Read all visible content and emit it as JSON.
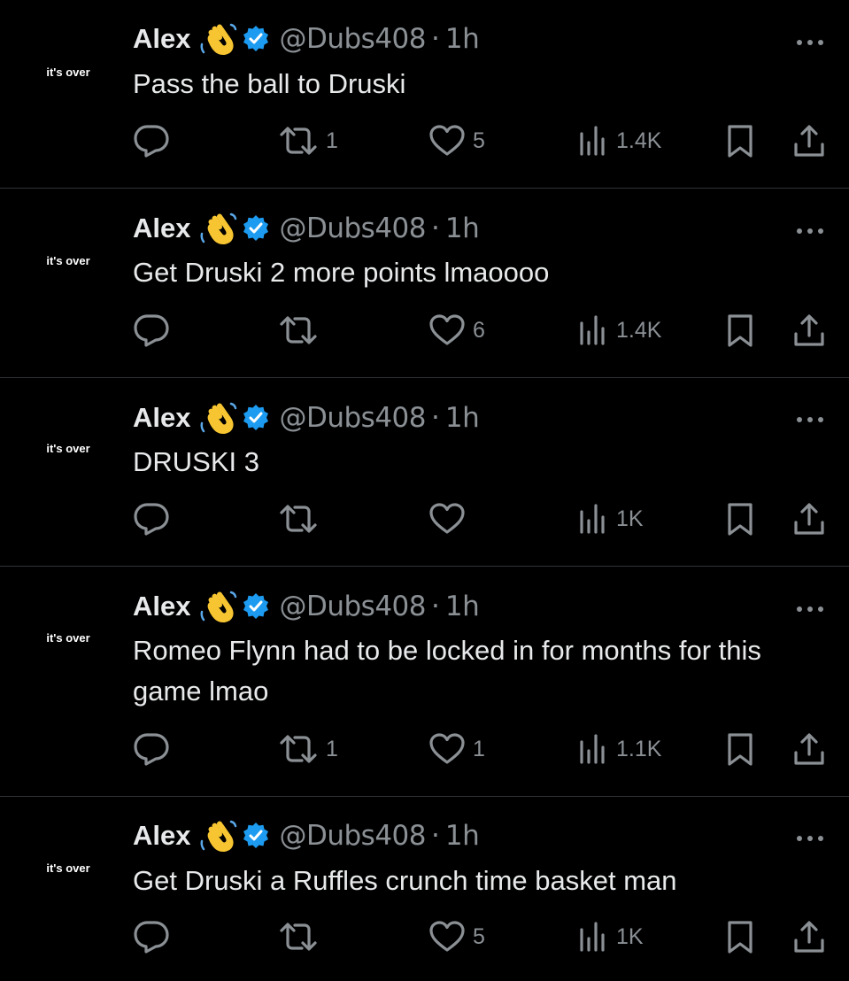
{
  "colors": {
    "background": "#000000",
    "text_primary": "#e7e9ea",
    "text_secondary": "#8b9095",
    "verified_blue": "#1d9bf0",
    "divider": "#2f3336"
  },
  "tweets": [
    {
      "avatar_text": "it's over",
      "name": "Alex",
      "emoji": "waving-hand",
      "handle": "@Dubs408",
      "dot": "·",
      "time": "1h",
      "text": "Pass the ball to Druski",
      "reply_count": "",
      "retweet_count": "1",
      "like_count": "5",
      "views": "1.4K"
    },
    {
      "avatar_text": "it's over",
      "name": "Alex",
      "emoji": "waving-hand",
      "handle": "@Dubs408",
      "dot": "·",
      "time": "1h",
      "text": "Get Druski 2 more points lmaoooo",
      "reply_count": "",
      "retweet_count": "",
      "like_count": "6",
      "views": "1.4K"
    },
    {
      "avatar_text": "it's over",
      "name": "Alex",
      "emoji": "waving-hand",
      "handle": "@Dubs408",
      "dot": "·",
      "time": "1h",
      "text": "DRUSKI 3",
      "reply_count": "",
      "retweet_count": "",
      "like_count": "",
      "views": "1K"
    },
    {
      "avatar_text": "it's over",
      "name": "Alex",
      "emoji": "waving-hand",
      "handle": "@Dubs408",
      "dot": "·",
      "time": "1h",
      "text": "Romeo Flynn had to be locked in for months for this game lmao",
      "reply_count": "",
      "retweet_count": "1",
      "like_count": "1",
      "views": "1.1K"
    },
    {
      "avatar_text": "it's over",
      "name": "Alex",
      "emoji": "waving-hand",
      "handle": "@Dubs408",
      "dot": "·",
      "time": "1h",
      "text": "Get Druski a Ruffles crunch time basket man",
      "reply_count": "",
      "retweet_count": "",
      "like_count": "5",
      "views": "1K"
    }
  ]
}
